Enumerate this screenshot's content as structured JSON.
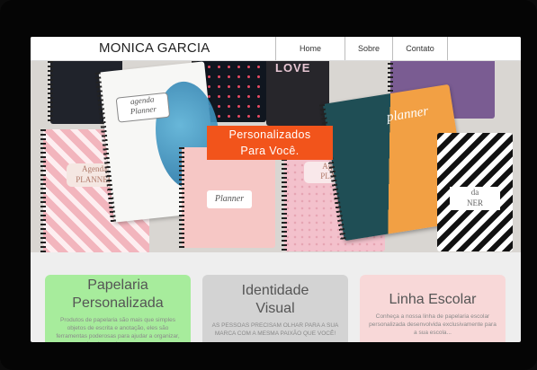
{
  "site": {
    "brand": "MONICA GARCIA"
  },
  "nav": {
    "items": [
      "Home",
      "Sobre",
      "Contato"
    ]
  },
  "hero": {
    "title_line1": "Personalizados",
    "title_line2": "Para Você.",
    "notebook_labels": {
      "agenda_top": "agenda",
      "planner_top": "Planner",
      "planner_pink": "Planner",
      "planner_dark": "planner",
      "agenda_left": "Agenda",
      "planner_left": "PLANNER",
      "love": "LOVE",
      "agen_mid": "Agen",
      "plan_mid": "PLAN",
      "da_right": "da",
      "ner_right": "NER"
    }
  },
  "cards": [
    {
      "title": "Papelaria Personalizada",
      "text": "Produtos de papelaria são mais que simples objetos de escrita e anotação, eles são ferramentas poderosas para ajudar a organizar, inspirar e alcançar seus",
      "bg": "#a7ec9c"
    },
    {
      "title": "Identidade Visual",
      "text": "AS PESSOAS PRECISAM OLHAR PARA A SUA MARCA COM A MESMA PAIXÃO QUE VOCÊ!",
      "bg": "#d3d3d3"
    },
    {
      "title": "Linha Escolar",
      "text": "Conheça a nossa linha de papelaria escolar personalizada desenvolvida exclusivamente para a sua escola...",
      "bg": "#f8d8d8"
    }
  ],
  "colors": {
    "accent": "#f2541b",
    "background": "#eeeeee",
    "frame": "#050505"
  },
  "icons": {
    "chat": "chat-icon"
  }
}
